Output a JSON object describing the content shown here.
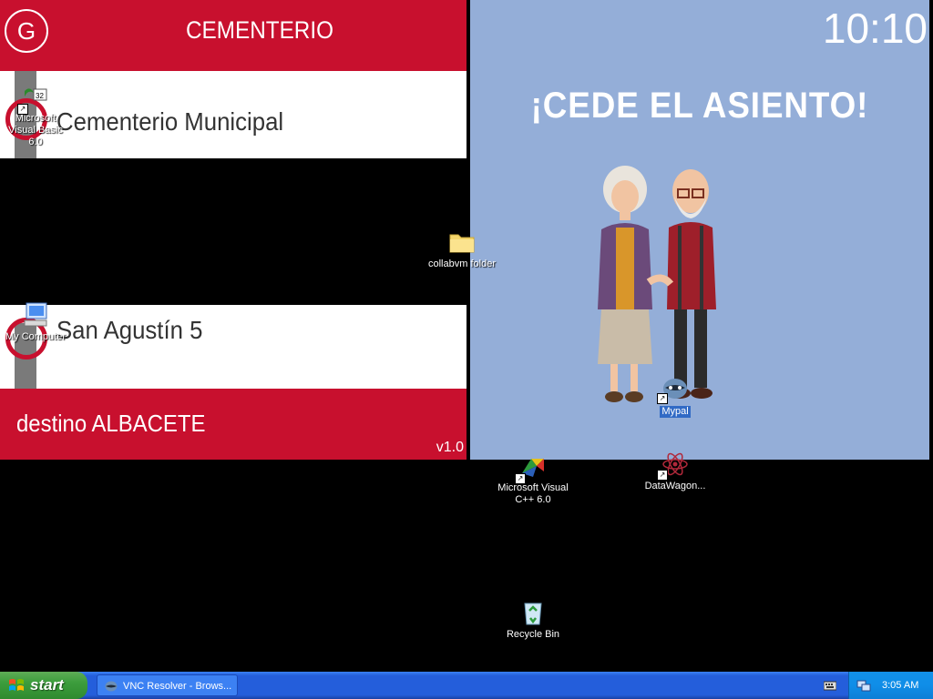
{
  "bus_display": {
    "header_letter": "G",
    "route_title": "CEMENTERIO",
    "stops": [
      {
        "name": "Cementerio Municipal"
      },
      {
        "name": "San Agustín 5"
      }
    ],
    "destination": "destino ALBACETE",
    "version": "v1.0"
  },
  "ad_panel": {
    "clock": "10:10",
    "headline": "¡CEDE EL ASIENTO!"
  },
  "desktop_icons": {
    "vb6": {
      "label": "Microsoft Visual Basic 6.0"
    },
    "my_computer": {
      "label": "My Computer"
    },
    "collabvm_folder": {
      "label": "collabvm folder"
    },
    "mypal": {
      "label": "Mypal"
    },
    "vcpp": {
      "label": "Microsoft Visual C++ 6.0"
    },
    "datawagon": {
      "label": "DataWagon..."
    },
    "recycle_bin": {
      "label": "Recycle Bin"
    }
  },
  "taskbar": {
    "start_label": "start",
    "tasks": [
      {
        "label": "VNC Resolver - Brows..."
      }
    ],
    "clock": "3:05 AM"
  },
  "colors": {
    "bus_red": "#c8102e",
    "ad_blue": "#94aed8",
    "taskbar_blue": "#245edb",
    "start_green": "#3c9d3c",
    "tray_blue": "#0f8ee8"
  }
}
